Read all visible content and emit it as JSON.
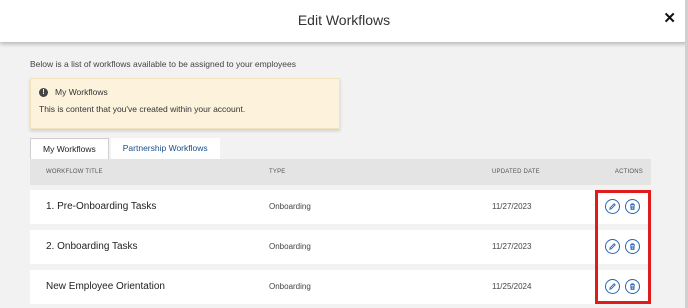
{
  "modal": {
    "title": "Edit Workflows",
    "close_label": "✕"
  },
  "intro_text": "Below is a list of workflows available to be assigned to your employees",
  "info_box": {
    "icon": "info-icon",
    "title": "My Workflows",
    "text": "This is content that you've created within your account."
  },
  "tabs": [
    {
      "label": "My Workflows",
      "active": true
    },
    {
      "label": "Partnership Workflows",
      "active": false
    }
  ],
  "table": {
    "headers": {
      "title": "WORKFLOW TITLE",
      "type": "TYPE",
      "updated": "UPDATED DATE",
      "actions": "ACTIONS"
    },
    "rows": [
      {
        "title": "1. Pre-Onboarding Tasks",
        "type": "Onboarding",
        "updated": "11/27/2023"
      },
      {
        "title": "2. Onboarding Tasks",
        "type": "Onboarding",
        "updated": "11/27/2023"
      },
      {
        "title": "New Employee Orientation",
        "type": "Onboarding",
        "updated": "11/25/2024"
      }
    ],
    "action_icons": [
      "pencil-icon",
      "trash-icon"
    ]
  },
  "colors": {
    "accent": "#2a64b2",
    "highlight": "#e01b1b",
    "info_bg": "#fdf3dc"
  }
}
